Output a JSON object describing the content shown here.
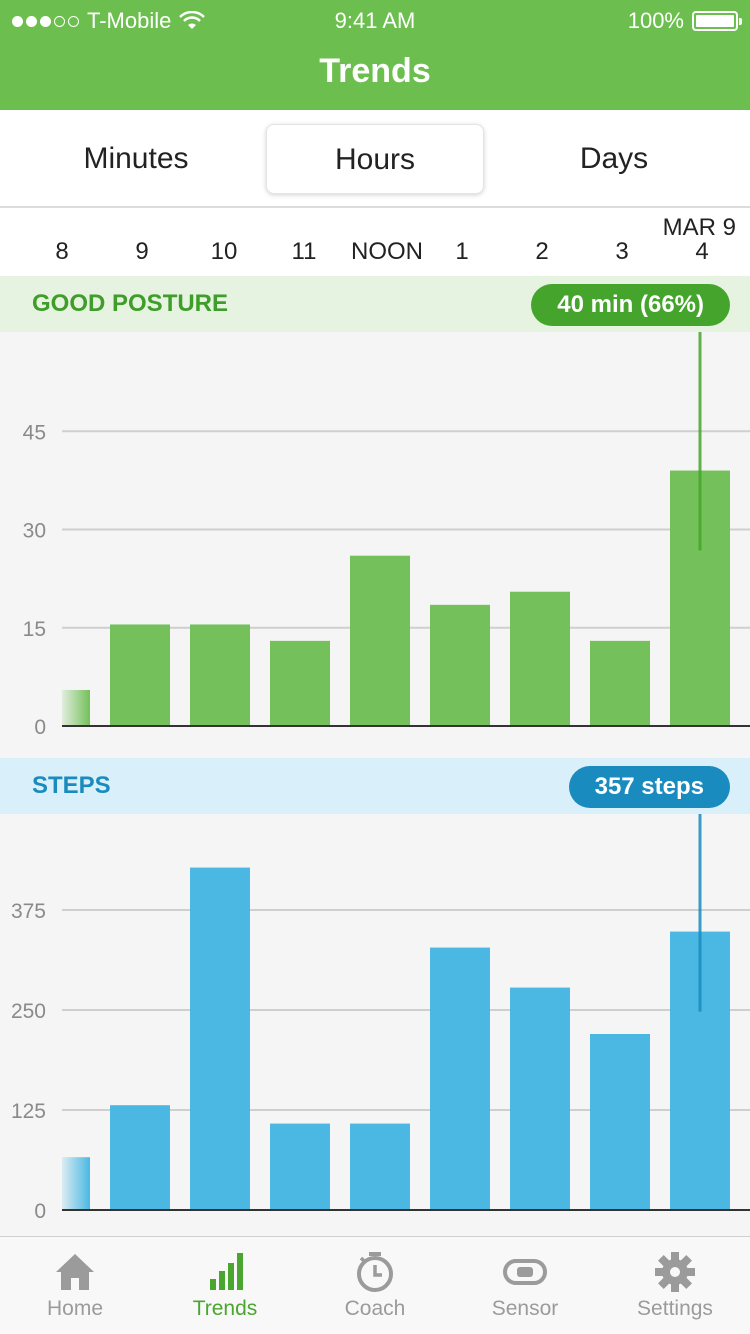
{
  "status_bar": {
    "carrier": "T-Mobile",
    "time": "9:41 AM",
    "battery": "100%"
  },
  "header": {
    "title": "Trends"
  },
  "segments": {
    "minutes": "Minutes",
    "hours": "Hours",
    "days": "Days",
    "active": "hours"
  },
  "time_axis": {
    "date": "MAR 9",
    "ticks": [
      "8",
      "9",
      "10",
      "11",
      "NOON",
      "1",
      "2",
      "3",
      "4"
    ]
  },
  "posture": {
    "title": "GOOD POSTURE",
    "pill": "40 min (66%)"
  },
  "steps": {
    "title": "STEPS",
    "pill": "357 steps"
  },
  "colors": {
    "header": "#6cbf4f",
    "posture_bar": "#74c05a",
    "steps_bar": "#4ab8e2",
    "posture_accent": "#45a42c",
    "steps_accent": "#1a8bbf"
  },
  "chart_data": [
    {
      "type": "bar",
      "categories": [
        "8",
        "9",
        "10",
        "11",
        "NOON",
        "1",
        "2",
        "3",
        "4"
      ],
      "values": [
        5.5,
        15.5,
        15.5,
        13,
        26,
        18.5,
        20.5,
        13,
        39
      ],
      "ylim": [
        0,
        60
      ],
      "yticks": [
        0,
        15,
        30,
        45
      ],
      "grid": true,
      "selected": "4"
    },
    {
      "type": "bar",
      "categories": [
        "8",
        "9",
        "10",
        "11",
        "NOON",
        "1",
        "2",
        "3",
        "4"
      ],
      "values": [
        66,
        131,
        428,
        108,
        108,
        328,
        278,
        220,
        348
      ],
      "ylim": [
        0,
        500
      ],
      "yticks": [
        0,
        125,
        250,
        375
      ],
      "grid": true,
      "selected": "4"
    }
  ],
  "tabs": [
    {
      "label": "Home",
      "icon": "home-icon",
      "active": false
    },
    {
      "label": "Trends",
      "icon": "trends-icon",
      "active": true
    },
    {
      "label": "Coach",
      "icon": "coach-icon",
      "active": false
    },
    {
      "label": "Sensor",
      "icon": "sensor-icon",
      "active": false
    },
    {
      "label": "Settings",
      "icon": "gear-icon",
      "active": false
    }
  ]
}
